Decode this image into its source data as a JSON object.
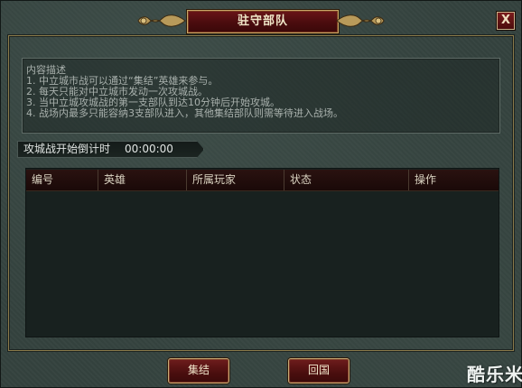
{
  "window": {
    "title": "驻守部队",
    "close_label": "X"
  },
  "description": {
    "heading": "内容描述",
    "lines": [
      "1. 中立城市战可以通过“集结”英雄来参与。",
      "2. 每天只能对中立城市发动一次攻城战。",
      "3. 当中立城攻城战的第一支部队到达10分钟后开始攻城。",
      "4. 战场内最多只能容纳3支部队进入，其他集结部队则需等待进入战场。"
    ]
  },
  "countdown": {
    "label": "攻城战开始倒计时",
    "time": "00:00:00"
  },
  "table": {
    "columns": [
      "编号",
      "英雄",
      "所属玩家",
      "状态",
      "操作"
    ],
    "rows": []
  },
  "buttons": {
    "gather": "集结",
    "return_home": "回国"
  },
  "watermark": "酷乐米",
  "colors": {
    "title_plate": "#4a0c0e",
    "panel_bg": "#34423e",
    "table_bg": "#18211f",
    "gold_border": "#c8a868"
  }
}
